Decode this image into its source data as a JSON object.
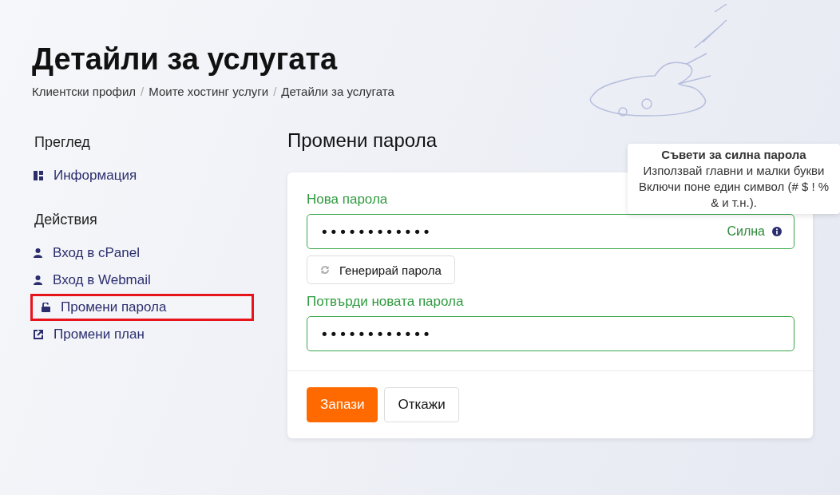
{
  "page": {
    "title": "Детайли за услугата"
  },
  "breadcrumb": {
    "separator": "/",
    "items": [
      "Клиентски профил",
      "Моите хостинг услуги",
      "Детайли за услугата"
    ]
  },
  "sidebar": [
    {
      "heading": "Преглед",
      "items": [
        {
          "label": "Информация",
          "kind": "grid",
          "selected": false
        }
      ]
    },
    {
      "heading": "Действия",
      "items": [
        {
          "label": "Вход в cPanel",
          "kind": "user",
          "selected": false
        },
        {
          "label": "Вход в Webmail",
          "kind": "user",
          "selected": false
        },
        {
          "label": "Промени парола",
          "kind": "lock",
          "selected": true
        },
        {
          "label": "Промени план",
          "kind": "external",
          "selected": false
        }
      ]
    }
  ],
  "form": {
    "title": "Промени парола",
    "new_password": {
      "label": "Нова парола",
      "value": "••••••••••••",
      "strength": "Силна"
    },
    "generate_button": "Генерирай парола",
    "confirm_password": {
      "label": "Потвърди новата парола",
      "value": "••••••••••••"
    },
    "buttons": [
      {
        "label": "Запази",
        "kind": "primary"
      },
      {
        "label": "Откажи",
        "kind": "secondary"
      }
    ]
  },
  "tooltip": {
    "title": "Съвети за силна парола",
    "lines": [
      "Използвай главни и малки букви",
      "Включи поне един символ (# $ ! % & и т.н.)."
    ]
  }
}
